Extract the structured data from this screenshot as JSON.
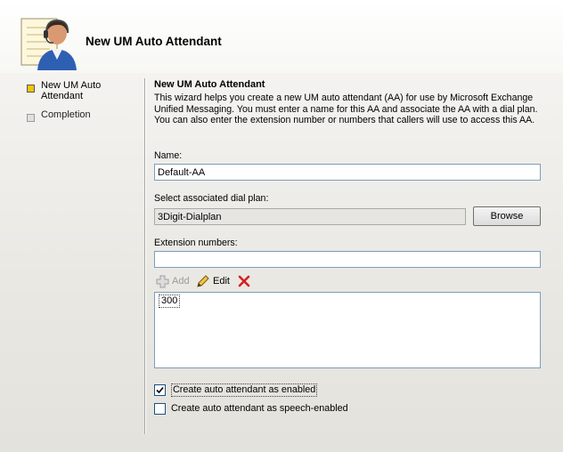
{
  "header": {
    "title": "New UM Auto Attendant",
    "icon": "speaking-person-headset-icon"
  },
  "steps": [
    {
      "label_line1": "New UM Auto",
      "label_line2": "Attendant",
      "state": "active"
    },
    {
      "label_line1": "Completion",
      "label_line2": "",
      "state": "inactive"
    }
  ],
  "main": {
    "title": "New UM Auto Attendant",
    "description": "This wizard helps you create a new UM auto attendant (AA) for use by Microsoft Exchange Unified Messaging. You must enter a name for this AA and associate the AA with a dial plan. You can also enter the extension number or numbers that callers will use to access this AA.",
    "name_label": "Name:",
    "name_value": "Default-AA",
    "dialplan_label": "Select associated dial plan:",
    "dialplan_value": "3Digit-Dialplan",
    "browse_label": "Browse",
    "extension_label": "Extension numbers:",
    "extension_value": "",
    "toolbar": {
      "add_label": "Add",
      "edit_label": "Edit",
      "remove_icon": "red-x-delete-icon"
    },
    "extensions": [
      "300"
    ],
    "checkbox_enabled_label": "Create auto attendant as enabled",
    "checkbox_enabled_checked": true,
    "checkbox_speech_label": "Create auto attendant as speech-enabled",
    "checkbox_speech_checked": false
  },
  "colors": {
    "active_step": "#f3c400",
    "input_border": "#7f9db9",
    "delete_red": "#d42020"
  }
}
